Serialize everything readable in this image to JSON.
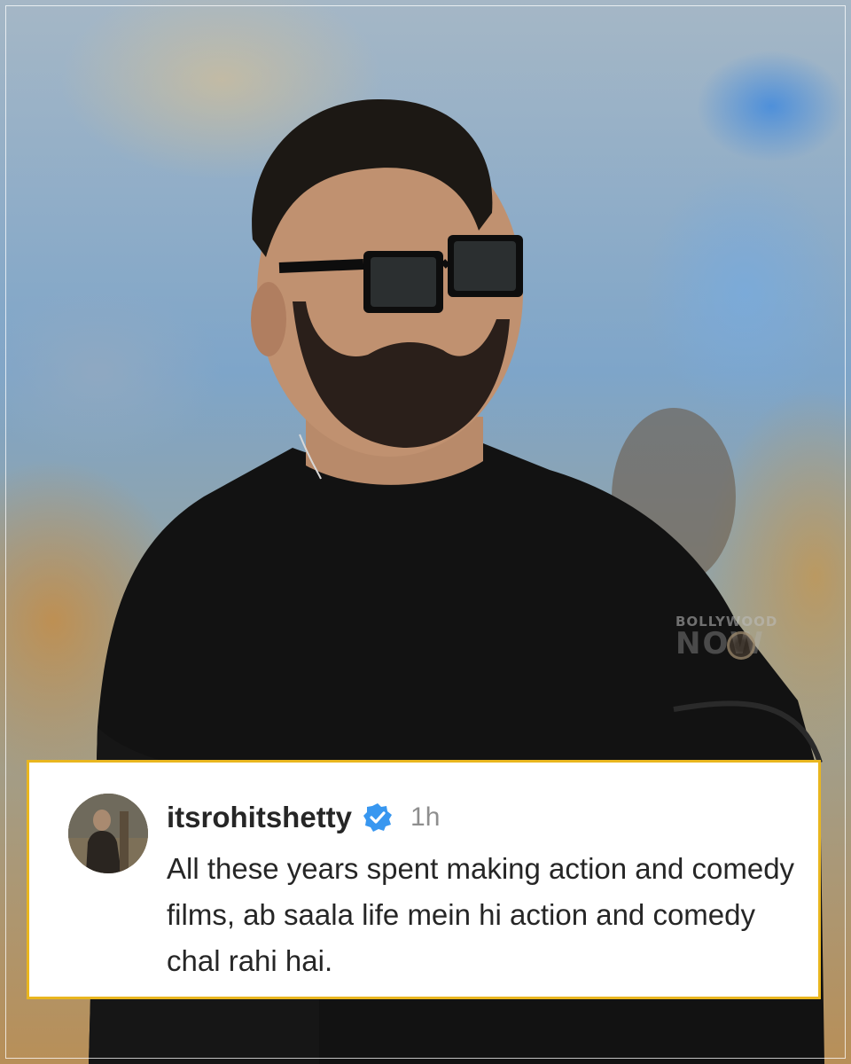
{
  "post": {
    "watermark": {
      "top": "BOLLYWOOD",
      "bottom": "NOW"
    },
    "comment": {
      "username": "itsrohitshetty",
      "verified": true,
      "time_ago": "1h",
      "text": "All these years spent making action and comedy films, ab saala life mein hi action and comedy chal rahi hai."
    }
  },
  "colors": {
    "card_border": "#e9b61f",
    "verified_badge": "#3897f0",
    "username": "#262626",
    "time": "#8e8e8e"
  }
}
